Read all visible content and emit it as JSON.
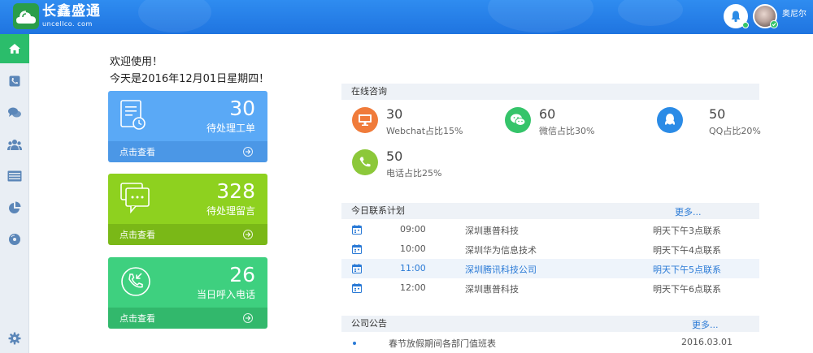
{
  "header": {
    "logo_cn": "长鑫盛通",
    "logo_en": "uncellco. com",
    "username": "奥尼尔"
  },
  "sidebar": {
    "items": [
      {
        "icon": "home-icon",
        "active": true
      },
      {
        "icon": "phone-icon"
      },
      {
        "icon": "chat-icon"
      },
      {
        "icon": "users-icon"
      },
      {
        "icon": "list-icon"
      },
      {
        "icon": "pie-chart-icon"
      },
      {
        "icon": "disc-icon"
      },
      {
        "icon": "gear-icon"
      }
    ]
  },
  "welcome": {
    "line1": "欢迎使用！",
    "line2": "今天是2016年12月01日星期四！"
  },
  "cards": [
    {
      "value": "30",
      "label": "待处理工单",
      "link": "点击查看",
      "color": "#5aa9f6"
    },
    {
      "value": "328",
      "label": "待处理留言",
      "link": "点击查看",
      "color": "#8ed11f"
    },
    {
      "value": "26",
      "label": "当日呼入电话",
      "link": "点击查看",
      "color": "#3ed07f"
    }
  ],
  "online": {
    "title": "在线咨询",
    "stats": [
      {
        "value": "30",
        "caption": "Webchat占比15%",
        "color": "#f07b3a",
        "icon": "monitor-icon"
      },
      {
        "value": "60",
        "caption": "微信占比30%",
        "color": "#35c46a",
        "icon": "wechat-icon"
      },
      {
        "value": "50",
        "caption": "QQ占比20%",
        "color": "#2b8be6",
        "icon": "qq-icon"
      },
      {
        "value": "50",
        "caption": "电话占比25%",
        "color": "#8cc83a",
        "icon": "phone-icon"
      }
    ]
  },
  "plan": {
    "title": "今日联系计划",
    "more": "更多...",
    "rows": [
      {
        "time": "09:00",
        "company": "深圳惠普科技",
        "note": "明天下午3点联系"
      },
      {
        "time": "10:00",
        "company": "深圳华为信息技术",
        "note": "明天下午4点联系"
      },
      {
        "time": "11:00",
        "company": "深圳腾讯科技公司",
        "note": "明天下午5点联系"
      },
      {
        "time": "12:00",
        "company": "深圳惠普科技",
        "note": "明天下午6点联系"
      }
    ]
  },
  "notices": {
    "title": "公司公告",
    "more": "更多...",
    "items": [
      {
        "title": "春节放假期间各部门值班表",
        "date": "2016.03.01"
      }
    ]
  }
}
